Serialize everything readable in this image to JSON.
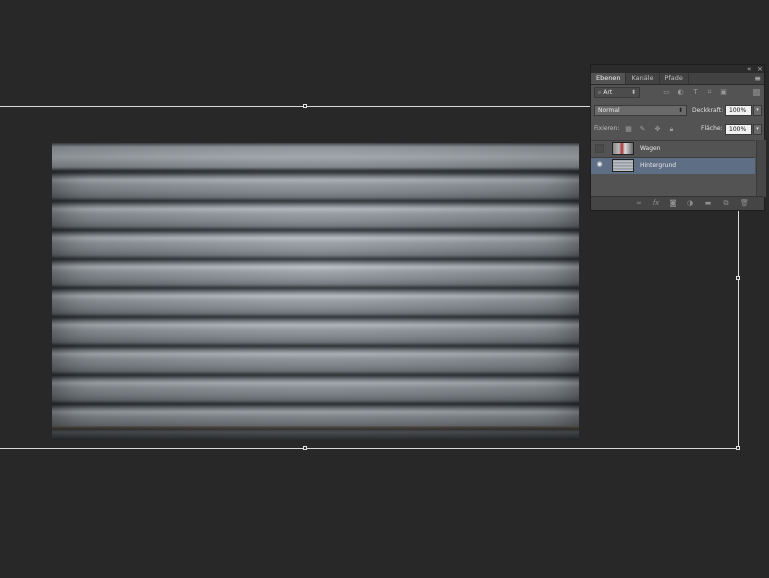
{
  "panel": {
    "collapse_glyph": "«",
    "close_glyph": "×",
    "menu_glyph": "≡",
    "tabs": [
      {
        "label": "Ebenen",
        "active": true
      },
      {
        "label": "Kanäle",
        "active": false
      },
      {
        "label": "Pfade",
        "active": false
      }
    ],
    "filter": {
      "value": "Art",
      "icon": "search-icon"
    },
    "filter_icons": [
      "image-filter-icon",
      "adjustment-filter-icon",
      "type-filter-icon",
      "shape-filter-icon",
      "smart-object-filter-icon"
    ],
    "blend_mode": "Normal",
    "opacity_label": "Deckkraft:",
    "opacity_value": "100%",
    "lock_label": "Fixieren:",
    "lock_icons": [
      "lock-transparent-icon",
      "lock-image-icon",
      "lock-position-icon",
      "lock-all-icon"
    ],
    "fill_label": "Fläche:",
    "fill_value": "100%",
    "layers": [
      {
        "name": "Wagen",
        "visible": false,
        "selected": false
      },
      {
        "name": "Hintergrund",
        "visible": true,
        "selected": true
      }
    ],
    "bottom_icons": [
      "link-icon",
      "fx-icon",
      "mask-icon",
      "adjustment-icon",
      "group-folder-icon",
      "new-layer-icon",
      "trash-icon"
    ]
  },
  "colors": {
    "background": "#282828",
    "panel": "#535353",
    "selection": "#5e6e84"
  }
}
